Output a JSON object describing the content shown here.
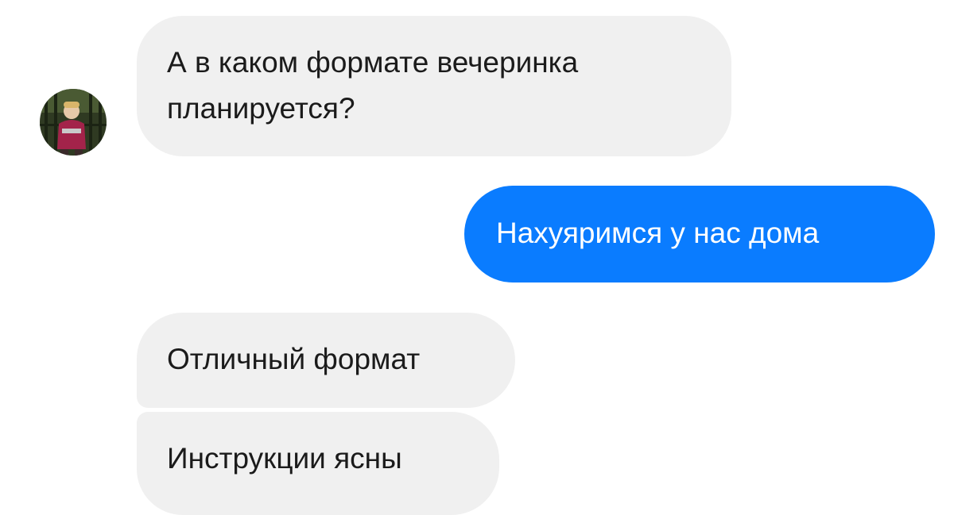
{
  "conversation": {
    "messages": [
      {
        "direction": "incoming",
        "text_lines": [
          "А в каком формате вечеринка",
          "планируется?"
        ]
      },
      {
        "direction": "outgoing",
        "text": "Нахуяримся у нас дома"
      },
      {
        "direction": "incoming",
        "text": "Отличный формат"
      },
      {
        "direction": "incoming",
        "text": "Инструкции ясны"
      }
    ],
    "contact": {
      "avatar_icon": "contact-avatar-photo"
    }
  },
  "colors": {
    "incoming_bubble": "#f0f0f0",
    "outgoing_bubble": "#0a7cff",
    "incoming_text": "#1b1b1b",
    "outgoing_text": "#ffffff",
    "background": "#ffffff"
  }
}
